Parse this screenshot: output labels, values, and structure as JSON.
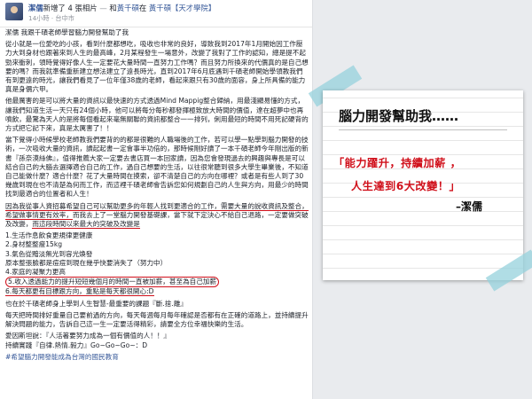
{
  "header": {
    "author": "潔儒",
    "action": "新增了 4 張相片",
    "separator1": "—",
    "with_text": "和",
    "tagged_person": "黃千碩",
    "at_text": "在",
    "place": "黃千碩【天才學院】",
    "time": "14小時",
    "location": "台中市"
  },
  "post": {
    "p1": "潔儒 我跟千碩老師學習腦力開發幫助了我",
    "p2": "從小就是一位愛吃的小孩，看到什麼都想吃，吸收也非常的良好，導致我到2017年1月開始因工作壓力大到身材也跟著來到人生的最高峰，2月某程發生一場意外，改變了我對了工作的認知，總是提不起勁來衝刺，領時覺得好像人生一定要花大量時間一直努力工作嗎？而且努力所換來的代價真的是自己想要的嗎？而我就準備重新建立想法建立了遠長時光，直到2017年6月底遇到千碩老師開始學領教我們有到更遠的時光，讓我們看見了一位年僅38歲的老師，看起來跟只有30歲的面容，身上所具備的能力真是身價六甲。",
    "p3": "他最厲害的是可以將大量的資訊以最快速的方式透過Mind Mappig整合歸納，用最淺顯易懂的方式，讓我們知道生活一天只有24個小時，他可以將每分每秒都發揮極致放大時間的價值，達在超夢中也再噴飲，最驚為天人的是將每個看起來毫無關聯的資訊都整合一一排列，俐用最短的時間不用死記硬背的方式把它記下來，真是太厲害了！！",
    "p4": "當下覺得小時候學校老師教我們要背的的都是很難的人職場後的工作，若可以學一點學到腦力開發的技術，一次吸收大量的資訊，讀起起書一定會事半功倍的，那時候剛好讀了一本千碩老師今年剛出版的新書『孫奈漠絲佛』，值得推薦大家一定要去書店買一本回家讀，因為您會發現過去的興趣與專長是可以結合自己的大腦去選擇適合自己的工作，過自己想要的生活，以往很常聽到很多大學生畢業後，不知道自己能做什麼？適合什麼？花了大量時間在摸索，卻不清楚自己的方向在哪裡？或者是有些人到了30幾歲到現在也不清楚為何而工作，而這裡千碩老師會告訴您如何規劃自己的人生與方向，用最少的時間找到最適合的位置者和人生！",
    "p5a": "因為我從事人資招募希望自己可以幫助更多的年輕人找到更適合的工作，需要大量的說收資訊及整合，希望做事情更有效率，",
    "p5b": "而我去上了一堂腦力開發基礎課，當下就下定決心不給自己退路，一定要做突破及改變，",
    "p5c": "而這段時間以來最大的突破及改變是",
    "list_1": "1.生活作息飲食更規律更健康",
    "list_2": "2.身材整整瘦15kg",
    "list_3": "3.氣色從黯淡無光到容光煥發",
    "list_3b": "原本整張臉都是痘痘到現在幾乎快要消失了（努力中）",
    "list_4": "4.家庭的凝聚力更高",
    "list_5": "5.收入透過能力的提升短短幾個月的時間一直被加薪，甚至為自己加薪",
    "list_6": "6.每天都更有目標跟方向，重點是每天都很開心:D",
    "p6": "也在於千碩老師身上學到人生智慧-最重要的課題『斷.捨.離』",
    "p7": "每天把時間排好重量自己要前過的方向，每天每週每月每年確認是否都有在正確的道路上，並持續提升解決問題的能力，告訴自己這一生一定要活得精彩，請要全方位幸福快樂的生活。",
    "p8": "愛因斯坦說：『人活著要努力成為一個有價值的人！！』",
    "p9": "持續實踐『自律.熱情.毅力』Go~Go~Go~：D",
    "hashtag": "#希望腦力開發能成為台灣的國民教育"
  },
  "card": {
    "title": "腦力開發幫助我……",
    "quote_line1": "「能力躍升，持續加薪 ，",
    "quote_line2": "人生達到6大改變！」",
    "signature": "–潔儒"
  },
  "colors": {
    "facebook_blue": "#365899",
    "highlight_red": "#d0101b",
    "tape": "#96d2dc"
  }
}
